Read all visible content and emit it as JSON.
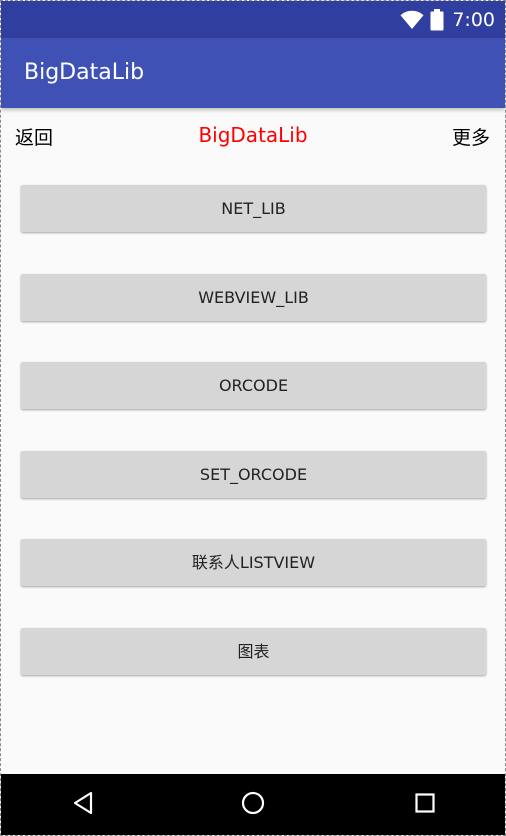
{
  "status_bar": {
    "time": "7:00",
    "icons": [
      "wifi-icon",
      "battery-icon"
    ]
  },
  "app_bar": {
    "title": "BigDataLib"
  },
  "title_row": {
    "back_label": "返回",
    "title": "BigDataLib",
    "more_label": "更多"
  },
  "buttons": [
    {
      "label": "NET_LIB"
    },
    {
      "label": "WEBVIEW_LIB"
    },
    {
      "label": "ORCODE"
    },
    {
      "label": "SET_ORCODE"
    },
    {
      "label": "联系人LISTVIEW"
    },
    {
      "label": "图表"
    }
  ],
  "navigation_bar": {
    "icons": [
      "back-triangle-icon",
      "home-circle-icon",
      "recents-square-icon"
    ]
  },
  "colors": {
    "status_bar": "#303f9f",
    "app_bar": "#3f51b5",
    "title_text": "#ff0000",
    "button_bg": "#d6d6d6",
    "background": "#fafafa"
  }
}
